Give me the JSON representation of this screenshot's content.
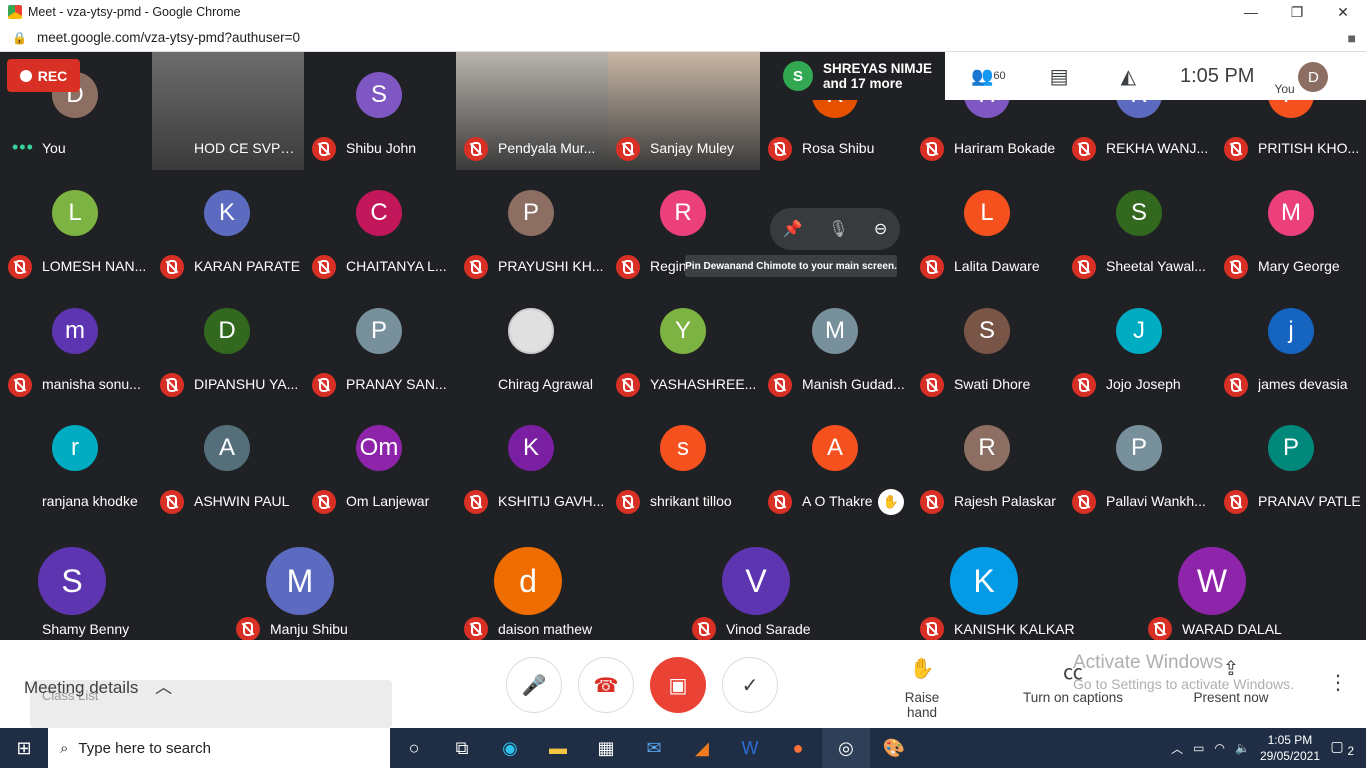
{
  "window": {
    "title": "Meet - vza-ytsy-pmd - Google Chrome",
    "url": "meet.google.com/vza-ytsy-pmd?authuser=0"
  },
  "rec_label": "REC",
  "presenter": {
    "initial": "S",
    "line1": "SHREYAS NIMJE",
    "line2": "and 17 more"
  },
  "topinfo": {
    "participants_count": "60",
    "time": "1:05 PM",
    "you_label": "You",
    "you_initial": "D"
  },
  "tooltip": "Pin Dewanand Chimote to your main screen.",
  "rows": [
    [
      {
        "initial": "D",
        "name": "You",
        "color": "#8d6e63",
        "muted": false,
        "speaking": true
      },
      {
        "initial": "",
        "name": "HOD CE SVPC...",
        "color": "#6d6d6d",
        "muted": false,
        "video": true
      },
      {
        "initial": "S",
        "name": "Shibu John",
        "color": "#7e57c2",
        "muted": true
      },
      {
        "initial": "",
        "name": "Pendyala Mur...",
        "color": "#b9b4ad",
        "muted": true,
        "video": true
      },
      {
        "initial": "",
        "name": "Sanjay Muley",
        "color": "#c9b7a6",
        "muted": true,
        "video": true
      },
      {
        "initial": "R",
        "name": "Rosa Shibu",
        "color": "#e65100",
        "muted": true
      },
      {
        "initial": "H",
        "name": "Hariram Bokade",
        "color": "#7e57c2",
        "muted": true
      },
      {
        "initial": "R",
        "name": "REKHA WANJ...",
        "color": "#5c6bc0",
        "muted": true
      },
      {
        "initial": "P",
        "name": "PRITISH KHO...",
        "color": "#f4511e",
        "muted": true
      }
    ],
    [
      {
        "initial": "L",
        "name": "LOMESH NAN...",
        "color": "#7cb342",
        "muted": true
      },
      {
        "initial": "K",
        "name": "KARAN PARATE",
        "color": "#5c6bc0",
        "muted": true
      },
      {
        "initial": "C",
        "name": "CHAITANYA L...",
        "color": "#c2185b",
        "muted": true
      },
      {
        "initial": "P",
        "name": "PRAYUSHI KH...",
        "color": "#8d6e63",
        "muted": true
      },
      {
        "initial": "R",
        "name": "Regin",
        "color": "#ec407a",
        "muted": true
      },
      {
        "initial": "",
        "name": "",
        "color": "#202124",
        "muted": false,
        "blank": true
      },
      {
        "initial": "L",
        "name": "Lalita Daware",
        "color": "#f4511e",
        "muted": true
      },
      {
        "initial": "S",
        "name": "Sheetal Yawal...",
        "color": "#33691e",
        "muted": true
      },
      {
        "initial": "M",
        "name": "Mary George",
        "color": "#ec407a",
        "muted": true
      }
    ],
    [
      {
        "initial": "m",
        "name": "manisha sonu...",
        "color": "#5e35b1",
        "muted": true
      },
      {
        "initial": "D",
        "name": "DIPANSHU YA...",
        "color": "#33691e",
        "muted": true
      },
      {
        "initial": "P",
        "name": "PRANAY SAN...",
        "color": "#78909c",
        "muted": true
      },
      {
        "initial": "",
        "name": "Chirag Agrawal",
        "color": "#e0e0e0",
        "muted": false,
        "photo": true
      },
      {
        "initial": "Y",
        "name": "YASHASHREE...",
        "color": "#7cb342",
        "muted": true
      },
      {
        "initial": "M",
        "name": "Manish Gudad...",
        "color": "#78909c",
        "muted": true
      },
      {
        "initial": "S",
        "name": "Swati Dhore",
        "color": "#795548",
        "muted": true
      },
      {
        "initial": "J",
        "name": "Jojo Joseph",
        "color": "#00acc1",
        "muted": true
      },
      {
        "initial": "j",
        "name": "james devasia",
        "color": "#1565c0",
        "muted": true
      }
    ],
    [
      {
        "initial": "r",
        "name": "ranjana khodke",
        "color": "#00acc1",
        "muted": false
      },
      {
        "initial": "A",
        "name": "ASHWIN PAUL",
        "color": "#546e7a",
        "muted": true
      },
      {
        "initial": "Om",
        "name": "Om Lanjewar",
        "color": "#8e24aa",
        "muted": true
      },
      {
        "initial": "K",
        "name": "KSHITIJ GAVH...",
        "color": "#7b1fa2",
        "muted": true
      },
      {
        "initial": "s",
        "name": "shrikant tilloo",
        "color": "#f4511e",
        "muted": true
      },
      {
        "initial": "A",
        "name": "A O Thakre",
        "color": "#f4511e",
        "muted": true,
        "hand": true
      },
      {
        "initial": "R",
        "name": "Rajesh Palaskar",
        "color": "#8d6e63",
        "muted": true
      },
      {
        "initial": "P",
        "name": "Pallavi Wankh...",
        "color": "#78909c",
        "muted": true
      },
      {
        "initial": "P",
        "name": "PRANAV PATLE",
        "color": "#00897b",
        "muted": true
      }
    ]
  ],
  "bigrow": [
    {
      "initial": "S",
      "name": "Shamy Benny",
      "color": "#5e35b1",
      "muted": false
    },
    {
      "initial": "M",
      "name": "Manju Shibu",
      "color": "#5c6bc0",
      "muted": true
    },
    {
      "initial": "d",
      "name": "daison mathew",
      "color": "#ef6c00",
      "muted": true
    },
    {
      "initial": "V",
      "name": "Vinod Sarade",
      "color": "#5e35b1",
      "muted": true
    },
    {
      "initial": "K",
      "name": "KANISHK KALKAR",
      "color": "#039be5",
      "muted": true
    },
    {
      "initial": "W",
      "name": "WARAD DALAL",
      "color": "#8e24aa",
      "muted": true
    }
  ],
  "bottom": {
    "meeting_details": "Meeting details",
    "raise_hand": "Raise hand",
    "captions": "Turn on captions",
    "present": "Present now",
    "class_list": "Class List",
    "watermark1": "Activate Windows",
    "watermark2": "Go to Settings to activate Windows."
  },
  "taskbar": {
    "search_placeholder": "Type here to search",
    "time": "1:05 PM",
    "date": "29/05/2021",
    "notifications": "2"
  }
}
